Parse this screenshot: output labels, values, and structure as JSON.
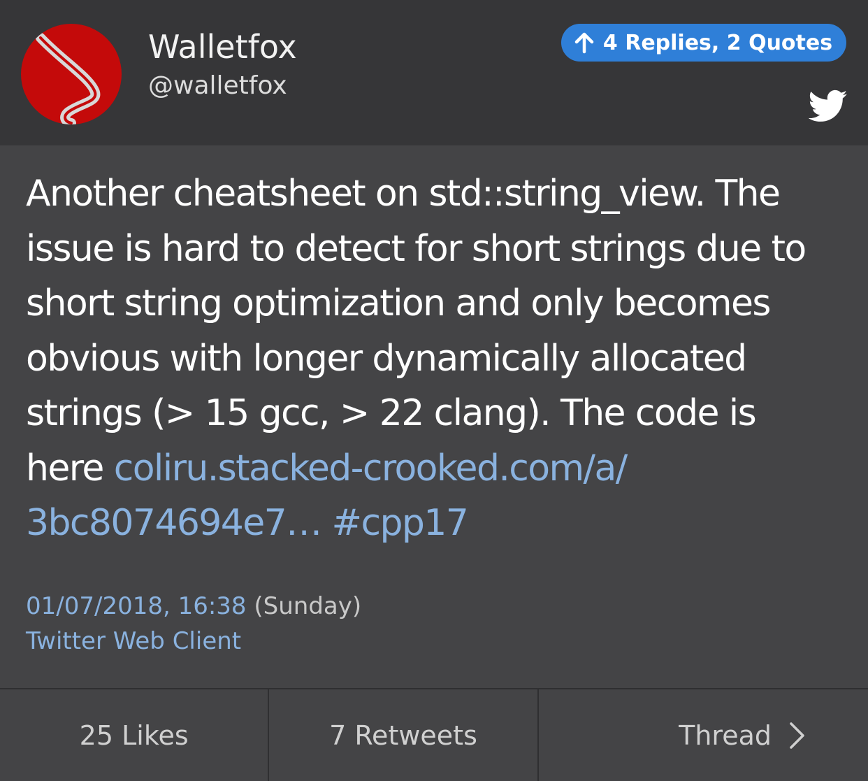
{
  "header": {
    "display_name": "Walletfox",
    "handle": "@walletfox",
    "replies_label": "4 Replies, 2 Quotes"
  },
  "tweet": {
    "text_lines": [
      "Another cheatsheet on std::string_view. The",
      "issue is hard to detect for short strings due to",
      "short string optimization and only becomes",
      "obvious with longer dynamically allocated",
      "strings (> 15 gcc,  > 22 clang). The code is"
    ],
    "line6_prefix": "here ",
    "link_part1": "coliru.stacked-crooked.com/a/",
    "link_part2": "3bc8074694e7…",
    "hashtag": "#cpp17"
  },
  "meta": {
    "date": "01/07/2018, 16:38",
    "day": "(Sunday)",
    "client": "Twitter Web Client"
  },
  "footer": {
    "likes": "25 Likes",
    "retweets": "7 Retweets",
    "thread": "Thread"
  },
  "colors": {
    "header_bg": "#363638",
    "body_bg": "#444446",
    "link": "#8ab2df",
    "pill": "#2f7fd8",
    "avatar": "#c40a0a"
  },
  "icons": [
    "arrow-up-icon",
    "twitter-bird-icon",
    "chevron-right-icon",
    "avatar-logo"
  ]
}
